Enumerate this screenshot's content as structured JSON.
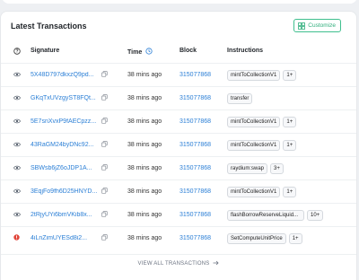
{
  "card": {
    "title": "Latest Transactions",
    "customize_label": "Customize"
  },
  "columns": {
    "signature": "Signature",
    "time": "Time",
    "block": "Block",
    "instructions": "Instructions"
  },
  "rows": [
    {
      "status": "success",
      "signature": "5X48D797dkxzQ9pd...",
      "time": "38 mins ago",
      "block": "315077868",
      "instruction": "mintToCollectionV1",
      "more": "1+"
    },
    {
      "status": "success",
      "signature": "GKqTxUVzgyST8FQt...",
      "time": "38 mins ago",
      "block": "315077868",
      "instruction": "transfer",
      "more": ""
    },
    {
      "status": "success",
      "signature": "5E7snXvxP9fAECpzz...",
      "time": "38 mins ago",
      "block": "315077868",
      "instruction": "mintToCollectionV1",
      "more": "1+"
    },
    {
      "status": "success",
      "signature": "43RaGM24byDNc92...",
      "time": "38 mins ago",
      "block": "315077868",
      "instruction": "mintToCollectionV1",
      "more": "1+"
    },
    {
      "status": "success",
      "signature": "SBWsb6jZ6oJDP1A...",
      "time": "38 mins ago",
      "block": "315077868",
      "instruction": "raydium:swap",
      "more": "3+"
    },
    {
      "status": "success",
      "signature": "3EqjFo9fh6D25HNYD...",
      "time": "38 mins ago",
      "block": "315077868",
      "instruction": "mintToCollectionV1",
      "more": "1+"
    },
    {
      "status": "success",
      "signature": "2tRjyUYi6bmVKib8x...",
      "time": "38 mins ago",
      "block": "315077868",
      "instruction": "flashBorrowReserveLiquid...",
      "more": "10+"
    },
    {
      "status": "error",
      "signature": "4iLnZimUYESd8i2...",
      "time": "38 mins ago",
      "block": "315077868",
      "instruction": "SetComputeUnitPrice",
      "more": "1+"
    }
  ],
  "footer": {
    "view_all_label": "VIEW ALL TRANSACTIONS"
  },
  "icons": {
    "status": "eye-icon",
    "error_status": "error-icon",
    "copy": "copy-icon",
    "time_info": "clock-icon",
    "customize": "grid-icon",
    "arrow": "arrow-right-icon"
  },
  "colors": {
    "link": "#2b7fd6",
    "accent": "#2fae7c",
    "error": "#e0453a"
  }
}
